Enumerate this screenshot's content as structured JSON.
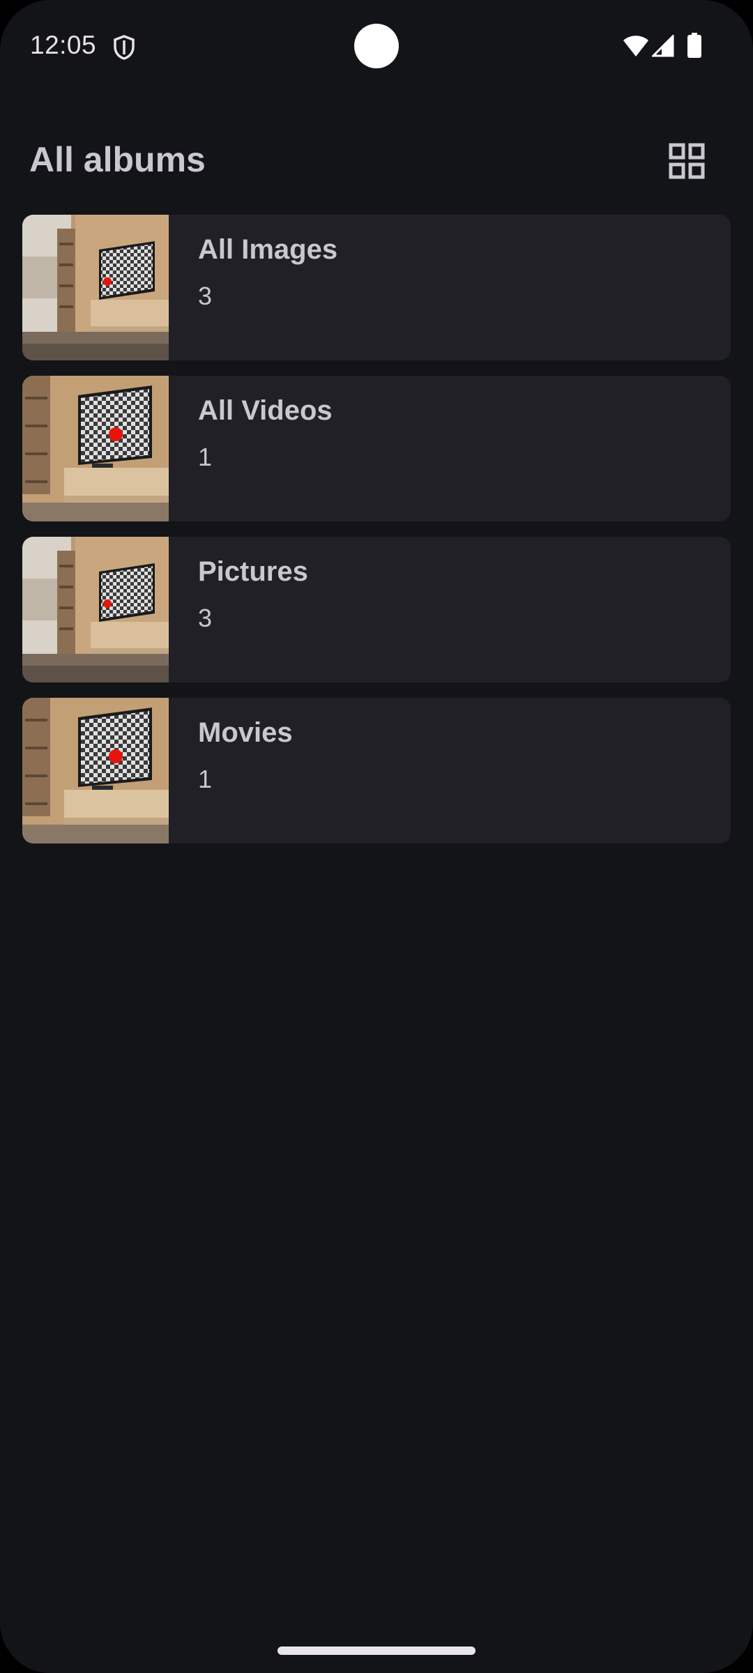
{
  "status_bar": {
    "time": "12:05",
    "icons": [
      "shield-icon",
      "wifi-icon",
      "cellular-signal-icon",
      "battery-icon"
    ]
  },
  "header": {
    "title": "All albums",
    "layout_toggle_icon": "grid-view-icon"
  },
  "albums": [
    {
      "name": "All Images",
      "count": "3",
      "thumbnail": "room-tv-wide"
    },
    {
      "name": "All Videos",
      "count": "1",
      "thumbnail": "room-tv-close"
    },
    {
      "name": "Pictures",
      "count": "3",
      "thumbnail": "room-tv-wide"
    },
    {
      "name": "Movies",
      "count": "1",
      "thumbnail": "room-tv-close"
    }
  ],
  "colors": {
    "background": "#131418",
    "card": "#202026",
    "text_primary": "#c9c7cf",
    "accent_red": "#e8140c"
  }
}
